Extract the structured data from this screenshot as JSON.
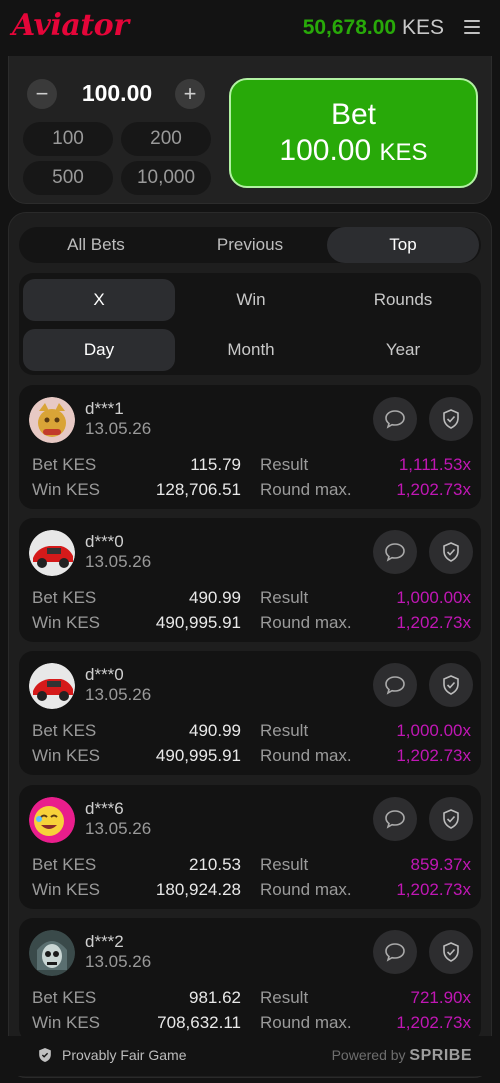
{
  "header": {
    "logo": "Aviator",
    "balance_amount": "50,678.00",
    "balance_currency": "KES"
  },
  "bet_panel": {
    "minus": "−",
    "plus": "+",
    "amount": "100.00",
    "quick_amounts": [
      "100",
      "200",
      "500",
      "10,000"
    ],
    "bet_label": "Bet",
    "bet_amount": "100.00",
    "bet_currency": "KES"
  },
  "tabs": [
    "All Bets",
    "Previous",
    "Top"
  ],
  "active_tab": "Top",
  "filters_row1": [
    "X",
    "Win",
    "Rounds"
  ],
  "filters_row2": [
    "Day",
    "Month",
    "Year"
  ],
  "labels": {
    "bet": "Bet KES",
    "win": "Win KES",
    "result": "Result",
    "round_max": "Round max."
  },
  "cards": [
    {
      "user": "d***1",
      "date": "13.05.26",
      "bet": "115.79",
      "win": "128,706.51",
      "result": "1,111.53x",
      "round_max": "1,202.73x",
      "avatar": "lucky-cat-avatar"
    },
    {
      "user": "d***0",
      "date": "13.05.26",
      "bet": "490.99",
      "win": "490,995.91",
      "result": "1,000.00x",
      "round_max": "1,202.73x",
      "avatar": "red-car-avatar"
    },
    {
      "user": "d***0",
      "date": "13.05.26",
      "bet": "490.99",
      "win": "490,995.91",
      "result": "1,000.00x",
      "round_max": "1,202.73x",
      "avatar": "red-car-avatar"
    },
    {
      "user": "d***6",
      "date": "13.05.26",
      "bet": "210.53",
      "win": "180,924.28",
      "result": "859.37x",
      "round_max": "1,202.73x",
      "avatar": "emoji-avatar"
    },
    {
      "user": "d***2",
      "date": "13.05.26",
      "bet": "981.62",
      "win": "708,632.11",
      "result": "721.90x",
      "round_max": "1,202.73x",
      "avatar": "skull-avatar"
    }
  ],
  "footer": {
    "provably_fair": "Provably Fair Game",
    "powered_by": "Powered by",
    "brand": "SPRIBE"
  },
  "colors": {
    "accent_green": "#28a909",
    "logo_red": "#e50539",
    "multiplier_magenta": "#c017b4"
  }
}
